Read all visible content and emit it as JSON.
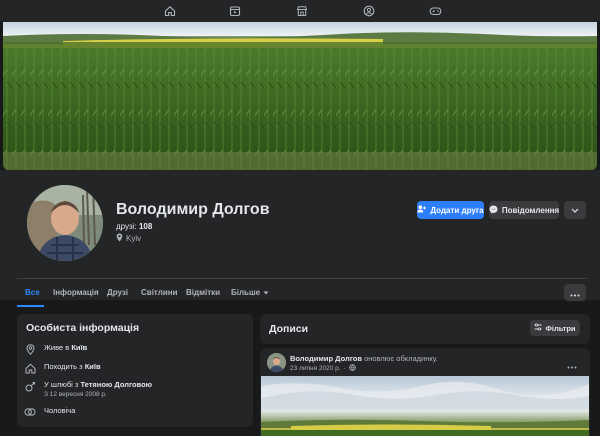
{
  "nav": {
    "icons": [
      "home-icon",
      "video-icon",
      "marketplace-icon",
      "groups-icon",
      "gaming-icon"
    ]
  },
  "profile": {
    "name": "Володимир Долгов",
    "friends_label": "друзі:",
    "friends_count": "108",
    "location": "Kyiv"
  },
  "actions": {
    "add_friend": "Додати друга",
    "message": "Повідомлення"
  },
  "tabs": [
    {
      "label": "Все",
      "active": true
    },
    {
      "label": "Інформація"
    },
    {
      "label": "Друзі"
    },
    {
      "label": "Світлини"
    },
    {
      "label": "Відмітки"
    },
    {
      "label": "Більше"
    }
  ],
  "intro": {
    "title": "Особиста інформація",
    "lives_prefix": "Живе в",
    "lives_city": "Київ",
    "from_prefix": "Походить з",
    "from_city": "Київ",
    "married_prefix": "У шлюбі з",
    "married_name": "Тетяною Долговою",
    "married_since": "З 12 вересня 2008 р.",
    "gender": "Чоловіча"
  },
  "posts": {
    "title": "Дописи",
    "filters": "Фільтри",
    "items": [
      {
        "author": "Володимир Долгов",
        "action": "оновлює обкладинку.",
        "date": "23 липня 2020 р."
      }
    ]
  },
  "colors": {
    "accent": "#2d88ff",
    "button_blue": "#2d7ff9",
    "background": "#18191a",
    "surface": "#242526"
  }
}
